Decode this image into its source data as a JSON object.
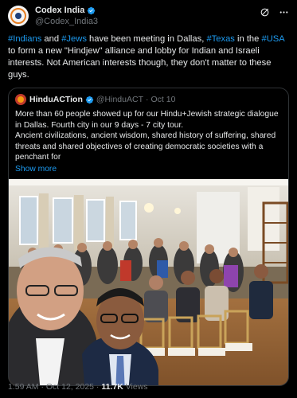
{
  "author": {
    "name": "Codex India",
    "handle": "@Codex_India3",
    "verified": true
  },
  "header_icons": [
    "grok-icon",
    "more-icon"
  ],
  "tweet": {
    "parts": [
      {
        "text": "#Indians",
        "tag": true
      },
      {
        "text": " and ",
        "tag": false
      },
      {
        "text": "#Jews",
        "tag": true
      },
      {
        "text": " have been meeting in Dallas, ",
        "tag": false
      },
      {
        "text": "#Texas",
        "tag": true
      },
      {
        "text": " in the ",
        "tag": false
      },
      {
        "text": "#USA",
        "tag": true
      },
      {
        "text": " to form a new \"Hindjew\" alliance and lobby for Indian and Israeli interests. Not American interests though, they don't matter to these guys.",
        "tag": false
      }
    ]
  },
  "quote": {
    "name": "HinduACTion",
    "handle": "@HinduACT",
    "date": "Oct 10",
    "text": "More than 60 people showed up for our Hindu+Jewish strategic dialogue in Dallas. Fourth city in our 9 days - 7 city tour.",
    "text2": "Ancient civilizations, ancient wisdom, shared history of suffering, shared threats and shared objectives of creating democratic societies with a penchant for",
    "show_more": "Show more"
  },
  "footer": {
    "time": "1:59 AM",
    "date": "Oct 12, 2025",
    "views": "11.7K",
    "views_label": "Views"
  },
  "colors": {
    "background": "#000000",
    "text": "#e7e9ea",
    "muted": "#71767b",
    "link": "#1d9bf0",
    "border": "#2f3336"
  }
}
